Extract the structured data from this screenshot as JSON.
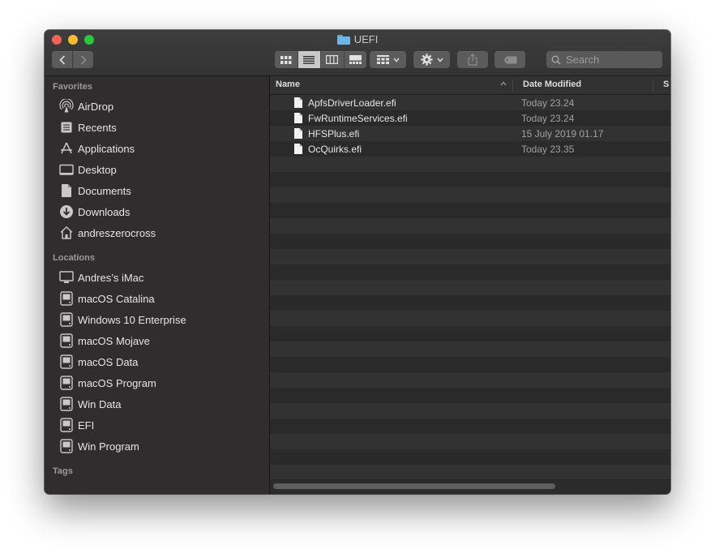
{
  "window": {
    "title": "UEFI"
  },
  "toolbar": {
    "back_icon": "chevron-left-icon",
    "forward_icon": "chevron-right-icon",
    "view_modes": [
      "icon-view",
      "list-view",
      "column-view",
      "gallery-view"
    ],
    "active_view": "list-view",
    "group_icon": "group-grid-icon",
    "action_icon": "gear-icon",
    "share_icon": "share-icon",
    "tag_icon": "tag-icon",
    "search": {
      "placeholder": "Search",
      "value": ""
    }
  },
  "sidebar": {
    "favorites_title": "Favorites",
    "favorites": [
      {
        "label": "AirDrop",
        "icon": "airdrop-icon"
      },
      {
        "label": "Recents",
        "icon": "recents-icon"
      },
      {
        "label": "Applications",
        "icon": "applications-icon"
      },
      {
        "label": "Desktop",
        "icon": "desktop-icon"
      },
      {
        "label": "Documents",
        "icon": "documents-icon"
      },
      {
        "label": "Downloads",
        "icon": "downloads-icon"
      },
      {
        "label": "andreszerocross",
        "icon": "home-icon"
      }
    ],
    "locations_title": "Locations",
    "locations": [
      {
        "label": "Andres’s iMac",
        "icon": "imac-icon"
      },
      {
        "label": "macOS Catalina",
        "icon": "disk-icon"
      },
      {
        "label": "Windows 10 Enterprise",
        "icon": "disk-icon"
      },
      {
        "label": "macOS Mojave",
        "icon": "disk-icon"
      },
      {
        "label": "macOS Data",
        "icon": "disk-icon"
      },
      {
        "label": "macOS Program",
        "icon": "disk-icon"
      },
      {
        "label": "Win Data",
        "icon": "disk-icon"
      },
      {
        "label": "EFI",
        "icon": "disk-icon"
      },
      {
        "label": "Win Program",
        "icon": "disk-icon"
      }
    ],
    "tags_title": "Tags"
  },
  "file_list": {
    "columns": {
      "name": "Name",
      "date": "Date Modified",
      "size": "S"
    },
    "files": [
      {
        "name": "ApfsDriverLoader.efi",
        "date": "Today 23.24"
      },
      {
        "name": "FwRuntimeServices.efi",
        "date": "Today 23.24"
      },
      {
        "name": "HFSPlus.efi",
        "date": "15 July 2019 01.17"
      },
      {
        "name": "OcQuirks.efi",
        "date": "Today 23.35"
      }
    ]
  },
  "colors": {
    "window_bg": "#323232",
    "sidebar_bg": "#2f2d2d",
    "text": "#e6e6e6",
    "muted_text": "#a0a0a0",
    "folder_accent": "#6bb6e6"
  }
}
